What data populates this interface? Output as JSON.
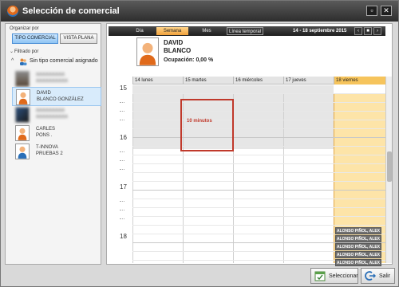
{
  "window": {
    "title": "Selección de comercial"
  },
  "left": {
    "organize_label": "Organizar por",
    "btn_tipo": "TIPO COMERCIAL",
    "btn_vista": "VISTA PLANA",
    "filter_label": "Filtrado por",
    "group_label": "Sin tipo comercial asignado",
    "employees": [
      {
        "line1": "XXXXXXXXX",
        "line2": "XXXXXXXXXX",
        "blurred": true
      },
      {
        "line1": "DAVID",
        "line2": "BLANCO GONZÁLEZ",
        "blurred": false
      },
      {
        "line1": "XXXXXXXXX",
        "line2": "XXXXXXXXXX",
        "blurred": true
      },
      {
        "line1": "CARLES",
        "line2": "PONS .",
        "blurred": false
      },
      {
        "line1": "T-INNOVA",
        "line2": "PRUEBAS 2",
        "blurred": false
      }
    ]
  },
  "calendar": {
    "tabs": [
      "Día",
      "Semana",
      "Mes",
      "Línea temporal"
    ],
    "date_range": "14 - 18 septiembre 2015",
    "nav": [
      "‹",
      "■",
      "›"
    ],
    "profile": {
      "name1": "DAVID",
      "name2": "BLANCO",
      "occupancy": "Ocupación: 0,00 %"
    },
    "days": [
      "14 lunes",
      "15 martes",
      "16 miércoles",
      "17 jueves",
      "18 viernes"
    ],
    "hours": [
      "15",
      "16",
      "17",
      "18"
    ],
    "selection_label": "10 minutos",
    "events": [
      "ALONSO PIÑOL, ALEX",
      "ALONSO PIÑOL, ALEX",
      "ALONSO PIÑOL, ALEX",
      "ALONSO PIÑOL, ALEX",
      "ALONSO PIÑOL, ALEX"
    ]
  },
  "actions": {
    "select": "Seleccionar",
    "exit": "Salir"
  },
  "colors": {
    "accent": "#f1a23b",
    "today": "#fde4a8",
    "selection": "#c0392b",
    "event": "#6f6f6f"
  }
}
